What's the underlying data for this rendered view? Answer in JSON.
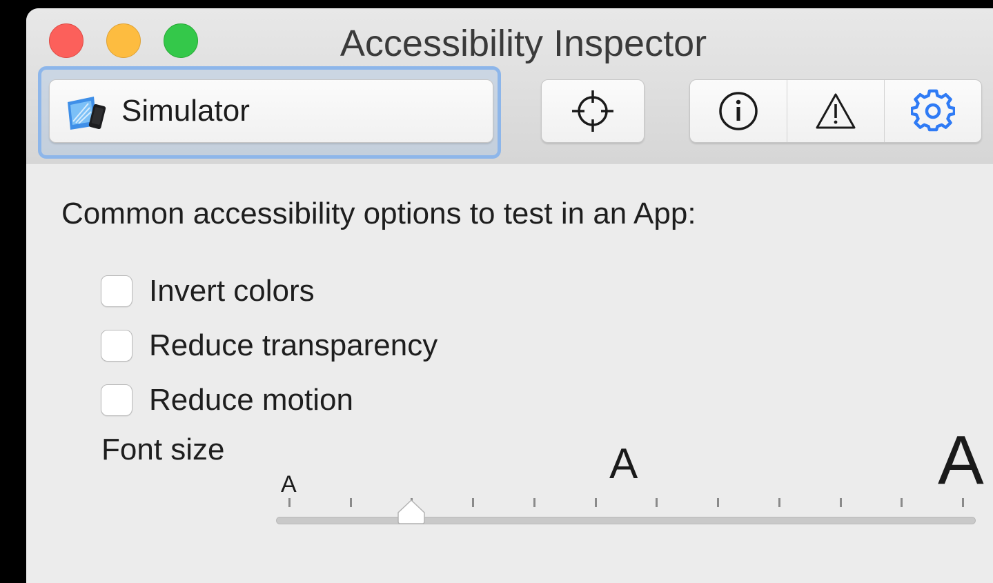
{
  "window": {
    "title": "Accessibility Inspector"
  },
  "toolbar": {
    "target_label": "Simulator",
    "buttons": [
      "point-to-inspect",
      "inspection",
      "audit",
      "settings"
    ]
  },
  "settings": {
    "heading": "Common accessibility options to test in an App:",
    "options": [
      {
        "label": "Invert colors",
        "checked": false
      },
      {
        "label": "Reduce transparency",
        "checked": false
      },
      {
        "label": "Reduce motion",
        "checked": false
      }
    ],
    "font_size": {
      "label": "Font size",
      "small_glyph": "A",
      "medium_glyph": "A",
      "large_glyph": "A",
      "steps": 12,
      "selected_step": 3
    }
  },
  "colors": {
    "accent": "#2f7bf5",
    "close": "#fc605b",
    "minimize": "#fdbc40",
    "maximize": "#34c84a"
  }
}
